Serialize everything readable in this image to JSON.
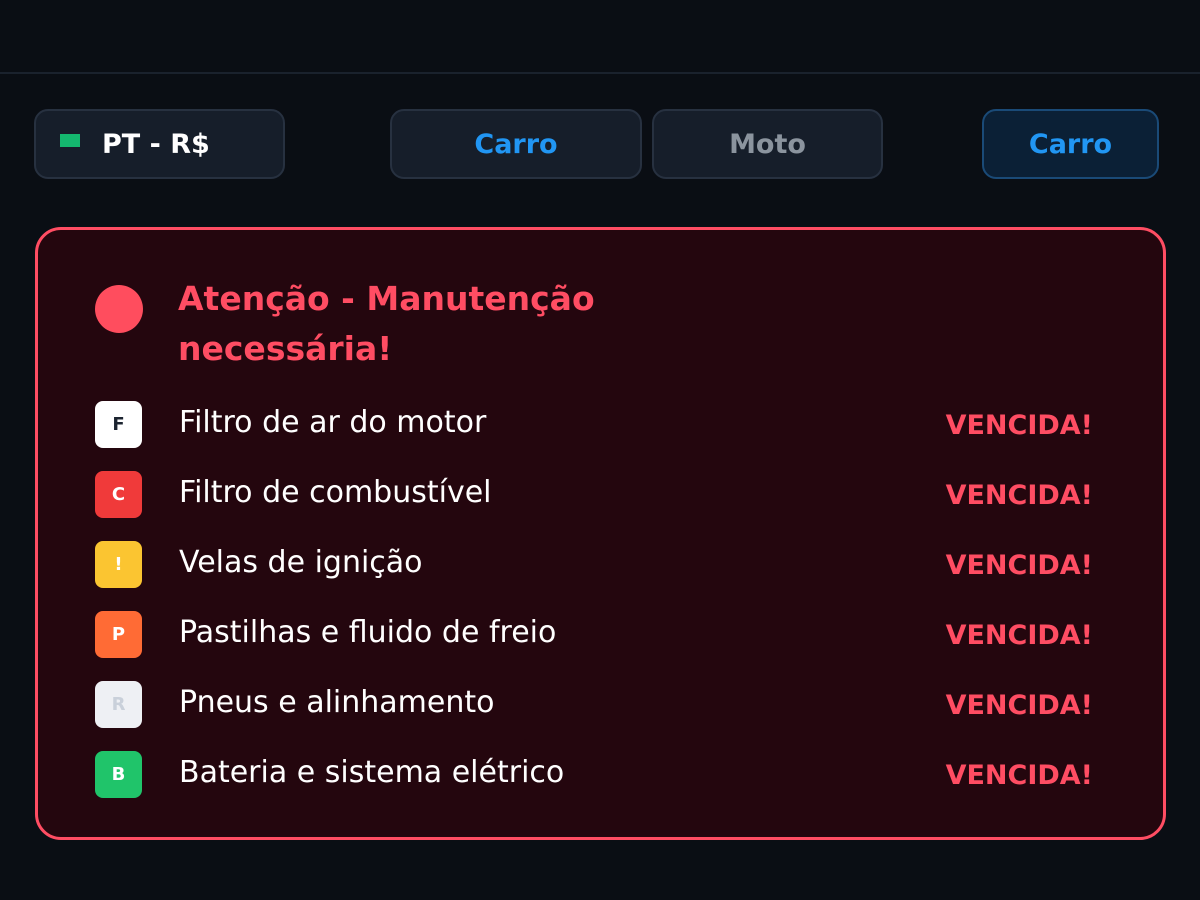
{
  "header": {
    "language_label": "PT - R$",
    "flag_color": "#14b86f",
    "tabs": [
      {
        "label": "Carro",
        "active": true
      },
      {
        "label": "Moto",
        "active": false
      }
    ],
    "mode_label": "Carro"
  },
  "alert": {
    "title": "Atenção - Manutenção necessária!",
    "accent_color": "#ff4d63",
    "items": [
      {
        "icon": "F",
        "icon_bg": "#ffffff",
        "icon_color": "#1c2430",
        "label": "Filtro de ar do motor",
        "status": "VENCIDA!"
      },
      {
        "icon": "C",
        "icon_bg": "#f03a3a",
        "icon_color": "#ffffff",
        "label": "Filtro de combustível",
        "status": "VENCIDA!"
      },
      {
        "icon": "!",
        "icon_bg": "#fbc531",
        "icon_color": "#ffffff",
        "label": "Velas de ignição",
        "status": "VENCIDA!"
      },
      {
        "icon": "P",
        "icon_bg": "#ff6b35",
        "icon_color": "#ffffff",
        "label": "Pastilhas e fluido de freio",
        "status": "VENCIDA!"
      },
      {
        "icon": "R",
        "icon_bg": "#eef0f4",
        "icon_color": "#c9d0da",
        "label": "Pneus e alinhamento",
        "status": "VENCIDA!"
      },
      {
        "icon": "B",
        "icon_bg": "#20c46a",
        "icon_color": "#ffffff",
        "label": "Bateria e sistema elétrico",
        "status": "VENCIDA!"
      }
    ]
  }
}
